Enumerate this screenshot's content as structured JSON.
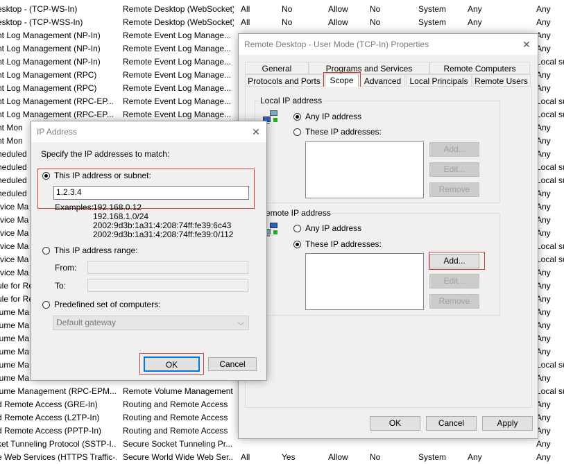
{
  "background_rules": [
    [
      "esktop - (TCP-WS-In)",
      "Remote Desktop (WebSocket)",
      "All",
      "No",
      "Allow",
      "No",
      "System",
      "Any",
      "Any"
    ],
    [
      "esktop - (TCP-WSS-In)",
      "Remote Desktop (WebSocket)",
      "All",
      "No",
      "Allow",
      "No",
      "System",
      "Any",
      "Any"
    ],
    [
      "nt Log Management (NP-In)",
      "Remote Event Log Manage...",
      "",
      "",
      "",
      "",
      "",
      "",
      "Any"
    ],
    [
      "nt Log Management (NP-In)",
      "Remote Event Log Manage...",
      "",
      "",
      "",
      "",
      "",
      "",
      "Any"
    ],
    [
      "nt Log Management (NP-In)",
      "Remote Event Log Manage...",
      "",
      "",
      "",
      "",
      "",
      "",
      "Local su"
    ],
    [
      "nt Log Management (RPC)",
      "Remote Event Log Manage...",
      "",
      "",
      "",
      "",
      "",
      "",
      "Any"
    ],
    [
      "nt Log Management (RPC)",
      "Remote Event Log Manage...",
      "",
      "",
      "",
      "",
      "",
      "",
      "Any"
    ],
    [
      "nt Log Management (RPC-EP...",
      "Remote Event Log Manage...",
      "",
      "",
      "",
      "",
      "",
      "",
      "Local su"
    ],
    [
      "nt Log Management (RPC-EP...",
      "Remote Event Log Manage...",
      "",
      "",
      "",
      "",
      "",
      "",
      "Local su"
    ],
    [
      "nt Mon",
      "",
      "",
      "",
      "",
      "",
      "",
      "",
      "Any"
    ],
    [
      "nt Mon",
      "",
      "",
      "",
      "",
      "",
      "",
      "",
      "Any"
    ],
    [
      "heduled",
      "",
      "",
      "",
      "",
      "",
      "",
      "",
      "Any"
    ],
    [
      "heduled",
      "",
      "",
      "",
      "",
      "",
      "",
      "",
      "Local su"
    ],
    [
      "heduled",
      "",
      "",
      "",
      "",
      "",
      "",
      "",
      "Local su"
    ],
    [
      "heduled",
      "",
      "",
      "",
      "",
      "",
      "",
      "",
      "Any"
    ],
    [
      "rvice Ma",
      "",
      "",
      "",
      "",
      "",
      "",
      "",
      "Any"
    ],
    [
      "rvice Ma",
      "",
      "",
      "",
      "",
      "",
      "",
      "",
      "Any"
    ],
    [
      "rvice Ma",
      "",
      "",
      "",
      "",
      "",
      "",
      "",
      "Any"
    ],
    [
      "rvice Ma",
      "",
      "",
      "",
      "",
      "",
      "",
      "",
      "Local su"
    ],
    [
      "rvice Ma",
      "",
      "",
      "",
      "",
      "",
      "",
      "",
      "Local su"
    ],
    [
      "rvice Ma",
      "",
      "",
      "",
      "",
      "",
      "",
      "",
      "Any"
    ],
    [
      "ule for Re",
      "",
      "",
      "",
      "",
      "",
      "",
      "",
      "Any"
    ],
    [
      "ule for Re",
      "",
      "",
      "",
      "",
      "",
      "",
      "",
      "Any"
    ],
    [
      "lume Ma",
      "",
      "",
      "",
      "",
      "",
      "",
      "",
      "Any"
    ],
    [
      "lume Ma",
      "",
      "",
      "",
      "",
      "",
      "",
      "",
      "Any"
    ],
    [
      "lume Ma",
      "",
      "",
      "",
      "",
      "",
      "",
      "",
      "Any"
    ],
    [
      "lume Ma",
      "",
      "",
      "",
      "",
      "",
      "",
      "",
      "Any"
    ],
    [
      "lume Ma",
      "",
      "",
      "",
      "",
      "",
      "",
      "",
      "Local su"
    ],
    [
      "lume Ma",
      "",
      "",
      "",
      "",
      "",
      "",
      "",
      "Any"
    ],
    [
      "lume Management (RPC-EPM...",
      "Remote Volume Management",
      "",
      "",
      "",
      "",
      "",
      "",
      "Local su"
    ],
    [
      "d Remote Access (GRE-In)",
      "Routing and Remote Access",
      "",
      "",
      "",
      "",
      "",
      "",
      "Any"
    ],
    [
      "d Remote Access (L2TP-In)",
      "Routing and Remote Access",
      "",
      "",
      "",
      "",
      "",
      "",
      "Any"
    ],
    [
      "d Remote Access (PPTP-In)",
      "Routing and Remote Access",
      "",
      "",
      "",
      "",
      "",
      "",
      "Any"
    ],
    [
      "ket Tunneling Protocol (SSTP-I...",
      "Secure Socket Tunneling Pr...",
      "",
      "",
      "",
      "",
      "",
      "",
      "Any"
    ],
    [
      "e Web Services (HTTPS Traffic-...",
      "Secure World Wide Web Ser...",
      "All",
      "Yes",
      "Allow",
      "No",
      "System",
      "Any",
      "Any"
    ]
  ],
  "props_dialog": {
    "title": "Remote Desktop - User Mode (TCP-In) Properties",
    "tabs_row1": [
      "General",
      "Programs and Services",
      "Remote Computers"
    ],
    "tabs_row2": [
      "Protocols and Ports",
      "Scope",
      "Advanced",
      "Local Principals",
      "Remote Users"
    ],
    "local": {
      "group_label": "Local IP address",
      "any_label": "Any IP address",
      "these_label": "These IP addresses:",
      "add": "Add...",
      "edit": "Edit...",
      "remove": "Remove"
    },
    "remote": {
      "group_label": "emote IP address",
      "any_label": "Any IP address",
      "these_label": "These IP addresses:",
      "add": "Add...",
      "edit": "Edit...",
      "remove": "Remove"
    },
    "ok": "OK",
    "cancel": "Cancel",
    "apply": "Apply"
  },
  "ip_dialog": {
    "title": "IP Address",
    "instruction": "Specify the IP addresses to match:",
    "subnet_label": "This IP address or subnet:",
    "subnet_value": "1.2.3.4",
    "examples_label": "Examples:",
    "examples": [
      "192.168.0.12",
      "192.168.1.0/24",
      "2002:9d3b:1a31:4:208:74ff:fe39:6c43",
      "2002:9d3b:1a31:4:208:74ff:fe39:0/112"
    ],
    "range_label": "This IP address range:",
    "from_label": "From:",
    "to_label": "To:",
    "predefined_label": "Predefined set of computers:",
    "predefined_value": "Default gateway",
    "ok": "OK",
    "cancel": "Cancel"
  },
  "colors": {
    "highlight": "#d23a3a",
    "dialog_bg": "#f0f0f0"
  }
}
